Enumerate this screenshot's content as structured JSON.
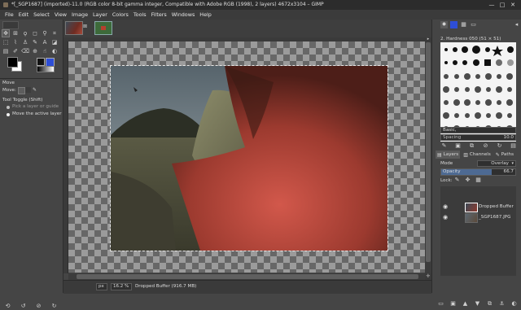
{
  "window": {
    "title": "*[_SGP1687] (imported)-11.0 (RGB color 8-bit gamma integer, Compatible with Adobe RGB (1998), 2 layers) 4672x3104 – GIMP",
    "minimize": "—",
    "maximize": "□",
    "close": "✕"
  },
  "menu": [
    "File",
    "Edit",
    "Select",
    "View",
    "Image",
    "Layer",
    "Colors",
    "Tools",
    "Filters",
    "Windows",
    "Help"
  ],
  "tool_options": {
    "title": "Move",
    "move_label": "Move:",
    "toggle_label": "Tool Toggle (Shift)",
    "option1": "Pick a layer or guide",
    "option2": "Move the active layer"
  },
  "brushes": {
    "header": "2. Hardness 050 (51 × 51)",
    "tag": "Basic,",
    "spacing_label": "Spacing",
    "spacing_value": "10.0"
  },
  "layers_panel": {
    "tabs": [
      "Layers",
      "Channels",
      "Paths"
    ],
    "mode_label": "Mode",
    "mode_value": "Overlay",
    "opacity_label": "Opacity",
    "opacity_value": "66.7",
    "lock_label": "Lock:",
    "layers": [
      {
        "name": "Dropped Buffer",
        "visible": true
      },
      {
        "name": "_SGP1687.JPG",
        "visible": true
      }
    ]
  },
  "status": {
    "unit": "px",
    "zoom": "16.2 %",
    "message": "Dropped Buffer (916.7 MB)"
  },
  "colors": {
    "fg": "#000000",
    "bg": "#ffffff",
    "accent_blue": "#2e4ed6"
  }
}
